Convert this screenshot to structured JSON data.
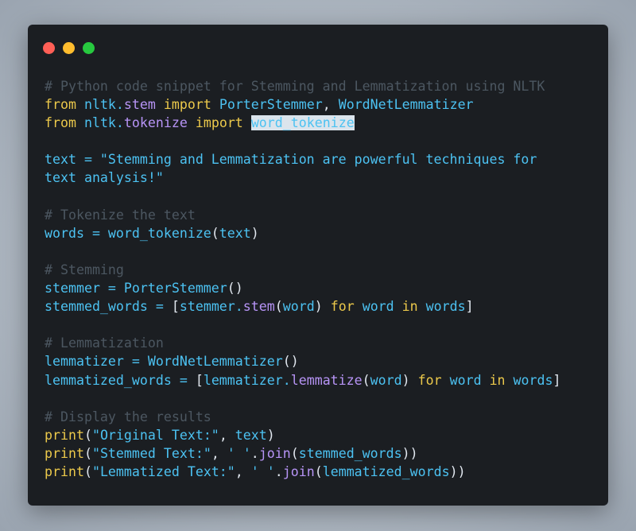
{
  "window": {
    "controls": [
      {
        "name": "close-button",
        "color": "#ff5f56"
      },
      {
        "name": "minimize-button",
        "color": "#ffbd2e"
      },
      {
        "name": "maximize-button",
        "color": "#27c93f"
      }
    ]
  },
  "code": {
    "lines": [
      [
        {
          "t": "# Python code snippet for Stemming and Lemmatization using NLTK",
          "k": "comment"
        }
      ],
      [
        {
          "t": "from",
          "k": "keyword"
        },
        {
          "t": " nltk.",
          "k": "text"
        },
        {
          "t": "stem",
          "k": "module"
        },
        {
          "t": " ",
          "k": "text"
        },
        {
          "t": "import",
          "k": "keyword"
        },
        {
          "t": " PorterStemmer",
          "k": "text"
        },
        {
          "t": ",",
          "k": "punct"
        },
        {
          "t": " WordNetLemmatizer",
          "k": "text"
        }
      ],
      [
        {
          "t": "from",
          "k": "keyword"
        },
        {
          "t": " nltk.",
          "k": "text"
        },
        {
          "t": "tokenize",
          "k": "module"
        },
        {
          "t": " ",
          "k": "text"
        },
        {
          "t": "import",
          "k": "keyword"
        },
        {
          "t": " ",
          "k": "text"
        },
        {
          "t": "word_tokenize",
          "k": "highlight"
        }
      ],
      [],
      [
        {
          "t": "text = \"Stemming and Lemmatization are powerful techniques for",
          "k": "text"
        }
      ],
      [
        {
          "t": "text analysis!\"",
          "k": "text"
        }
      ],
      [],
      [
        {
          "t": "# Tokenize the text",
          "k": "comment"
        }
      ],
      [
        {
          "t": "words = word_tokenize",
          "k": "text"
        },
        {
          "t": "(",
          "k": "punct"
        },
        {
          "t": "text",
          "k": "text"
        },
        {
          "t": ")",
          "k": "punct"
        }
      ],
      [],
      [
        {
          "t": "# Stemming",
          "k": "comment"
        }
      ],
      [
        {
          "t": "stemmer = PorterStemmer",
          "k": "text"
        },
        {
          "t": "()",
          "k": "punct"
        }
      ],
      [
        {
          "t": "stemmed_words = ",
          "k": "text"
        },
        {
          "t": "[",
          "k": "punct"
        },
        {
          "t": "stemmer.",
          "k": "text"
        },
        {
          "t": "stem",
          "k": "module"
        },
        {
          "t": "(",
          "k": "punct"
        },
        {
          "t": "word",
          "k": "text"
        },
        {
          "t": ")",
          "k": "punct"
        },
        {
          "t": " ",
          "k": "text"
        },
        {
          "t": "for",
          "k": "keyword"
        },
        {
          "t": " word ",
          "k": "text"
        },
        {
          "t": "in",
          "k": "keyword"
        },
        {
          "t": " words",
          "k": "text"
        },
        {
          "t": "]",
          "k": "punct"
        }
      ],
      [],
      [
        {
          "t": "# Lemmatization",
          "k": "comment"
        }
      ],
      [
        {
          "t": "lemmatizer = WordNetLemmatizer",
          "k": "text"
        },
        {
          "t": "()",
          "k": "punct"
        }
      ],
      [
        {
          "t": "lemmatized_words = ",
          "k": "text"
        },
        {
          "t": "[",
          "k": "punct"
        },
        {
          "t": "lemmatizer.",
          "k": "text"
        },
        {
          "t": "lemmatize",
          "k": "module"
        },
        {
          "t": "(",
          "k": "punct"
        },
        {
          "t": "word",
          "k": "text"
        },
        {
          "t": ")",
          "k": "punct"
        },
        {
          "t": " ",
          "k": "text"
        },
        {
          "t": "for",
          "k": "keyword"
        },
        {
          "t": " word ",
          "k": "text"
        },
        {
          "t": "in",
          "k": "keyword"
        },
        {
          "t": " words",
          "k": "text"
        },
        {
          "t": "]",
          "k": "punct"
        }
      ],
      [],
      [
        {
          "t": "# Display the results",
          "k": "comment"
        }
      ],
      [
        {
          "t": "print",
          "k": "keyword"
        },
        {
          "t": "(",
          "k": "punct"
        },
        {
          "t": "\"Original Text:\"",
          "k": "text"
        },
        {
          "t": ", ",
          "k": "punct"
        },
        {
          "t": "text",
          "k": "text"
        },
        {
          "t": ")",
          "k": "punct"
        }
      ],
      [
        {
          "t": "print",
          "k": "keyword"
        },
        {
          "t": "(",
          "k": "punct"
        },
        {
          "t": "\"Stemmed Text:\"",
          "k": "text"
        },
        {
          "t": ", ",
          "k": "punct"
        },
        {
          "t": "' '",
          "k": "text"
        },
        {
          "t": ".",
          "k": "punct"
        },
        {
          "t": "join",
          "k": "module"
        },
        {
          "t": "(",
          "k": "punct"
        },
        {
          "t": "stemmed_words",
          "k": "text"
        },
        {
          "t": "))",
          "k": "punct"
        }
      ],
      [
        {
          "t": "print",
          "k": "keyword"
        },
        {
          "t": "(",
          "k": "punct"
        },
        {
          "t": "\"Lemmatized Text:\"",
          "k": "text"
        },
        {
          "t": ", ",
          "k": "punct"
        },
        {
          "t": "' '",
          "k": "text"
        },
        {
          "t": ".",
          "k": "punct"
        },
        {
          "t": "join",
          "k": "module"
        },
        {
          "t": "(",
          "k": "punct"
        },
        {
          "t": "lemmatized_words",
          "k": "text"
        },
        {
          "t": "))",
          "k": "punct"
        }
      ]
    ]
  }
}
